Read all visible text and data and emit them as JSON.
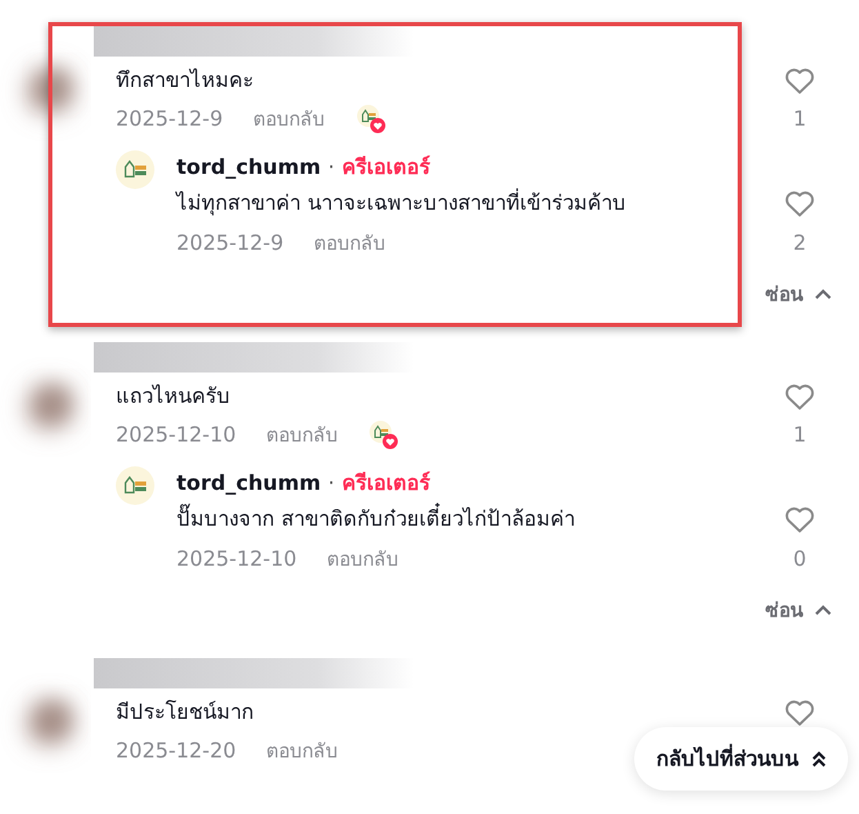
{
  "comments": [
    {
      "highlighted": true,
      "text": "ทึกสาขาไหมคะ",
      "date": "2025-12-9",
      "reply_label": "ตอบกลับ",
      "creator_liked": true,
      "likes": "1",
      "replies": [
        {
          "username": "tord_chumm",
          "separator": "·",
          "badge": "ครีเอเตอร์",
          "text": "ไม่ทุกสาขาค่า นาาจะเฉพาะบางสาขาที่เข้าร่วมค้าบ",
          "date": "2025-12-9",
          "reply_label": "ตอบกลับ",
          "likes": "2"
        }
      ],
      "hide_label": "ซ่อน"
    },
    {
      "highlighted": false,
      "text": "แถวไหนครับ",
      "date": "2025-12-10",
      "reply_label": "ตอบกลับ",
      "creator_liked": true,
      "likes": "1",
      "replies": [
        {
          "username": "tord_chumm",
          "separator": "·",
          "badge": "ครีเอเตอร์",
          "text": "ปั๊มบางจาก สาขาติดกับก๋วยเตี๋ยวไก่ป้าล้อมค่า",
          "date": "2025-12-10",
          "reply_label": "ตอบกลับ",
          "likes": "0"
        }
      ],
      "hide_label": "ซ่อน"
    },
    {
      "highlighted": false,
      "text": "มีประโยชน์มาก",
      "date": "2025-12-20",
      "reply_label": "ตอบกลับ",
      "creator_liked": false
    }
  ],
  "back_to_top": {
    "label": "กลับไปที่ส่วนบน"
  }
}
